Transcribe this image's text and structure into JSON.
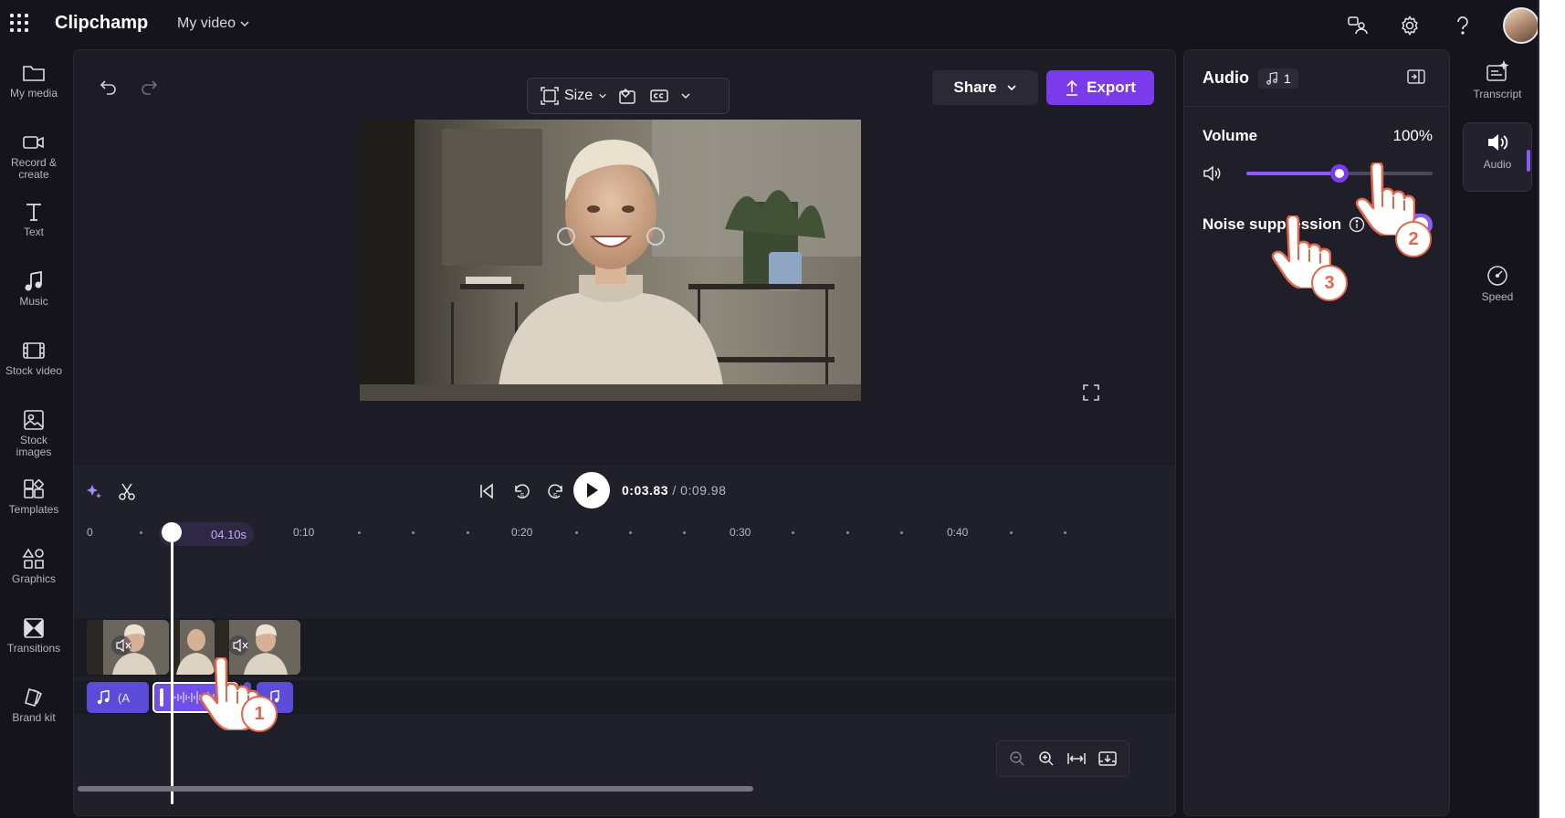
{
  "app": {
    "name": "Clipchamp",
    "project_title": "My video"
  },
  "left_rail": [
    {
      "id": "my-media",
      "label": "My media"
    },
    {
      "id": "record-create",
      "label": "Record &\ncreate"
    },
    {
      "id": "text",
      "label": "Text"
    },
    {
      "id": "music",
      "label": "Music"
    },
    {
      "id": "stock-video",
      "label": "Stock video"
    },
    {
      "id": "stock-images",
      "label": "Stock\nimages"
    },
    {
      "id": "templates",
      "label": "Templates"
    },
    {
      "id": "graphics",
      "label": "Graphics"
    },
    {
      "id": "transitions",
      "label": "Transitions"
    },
    {
      "id": "brand-kit",
      "label": "Brand kit"
    }
  ],
  "toolbar": {
    "size_label": "Size",
    "share_label": "Share",
    "export_label": "Export"
  },
  "playback": {
    "current": "0:03.83",
    "separator": " / ",
    "total": "0:09.98"
  },
  "timeline": {
    "playhead_time": "04.10s",
    "ticks": [
      "0",
      "0:10",
      "0:20",
      "0:30",
      "0:40"
    ],
    "audio_clip_text": "(A"
  },
  "audio_panel": {
    "title": "Audio",
    "track_count": "1",
    "volume_label": "Volume",
    "volume_value": "100%",
    "volume_level": 0.5,
    "noise_label": "Noise suppression",
    "noise_enabled": true
  },
  "side_rail": [
    {
      "id": "transcript",
      "label": "Transcript"
    },
    {
      "id": "audio",
      "label": "Audio",
      "active": true
    },
    {
      "id": "speed",
      "label": "Speed"
    }
  ],
  "steps": [
    "1",
    "2",
    "3"
  ],
  "colors": {
    "accent": "#7c3aed",
    "step_ring": "#e2674a",
    "background": "#15141c"
  }
}
